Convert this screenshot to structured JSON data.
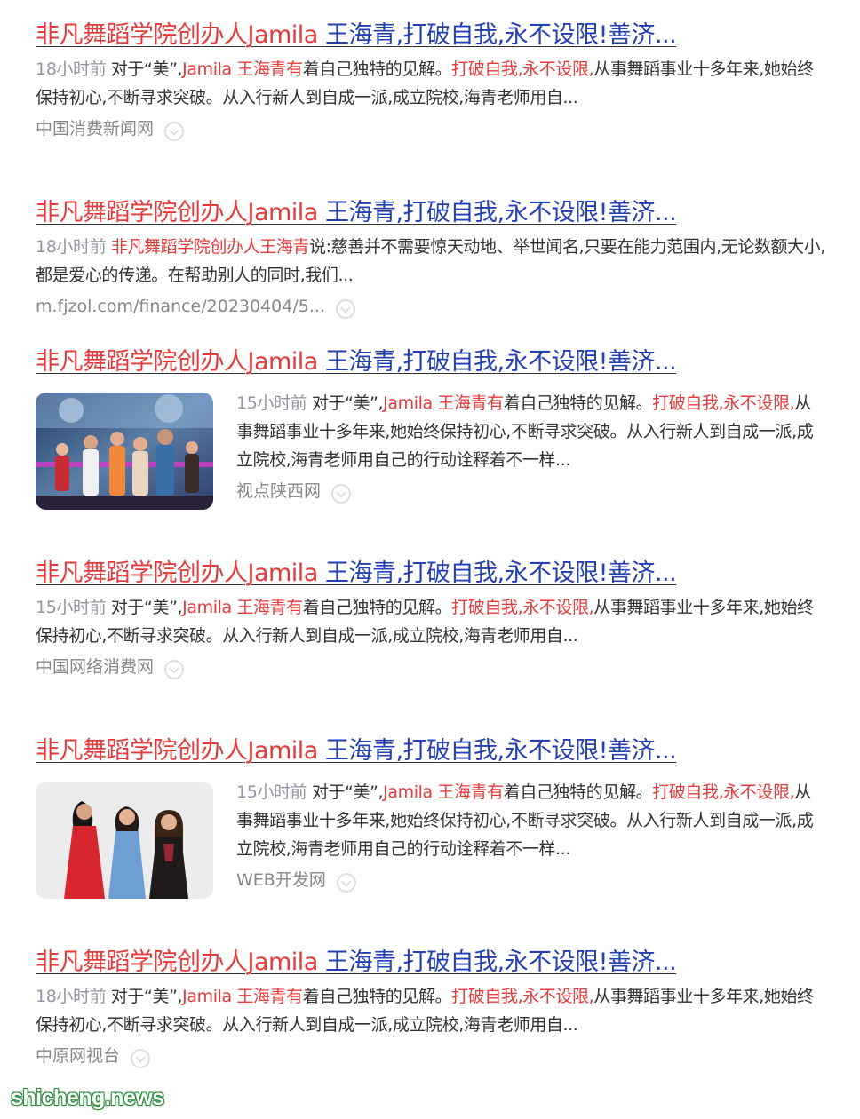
{
  "results": [
    {
      "title_red": "非凡舞蹈学院创办人Jamila ",
      "title_blue": "王海青,打破自我,永不设限!善济...",
      "time": "18小时前",
      "abstract_parts": [
        {
          "text": " 对于“美”,",
          "hl": false
        },
        {
          "text": "Jamila 王海青有",
          "hl": true
        },
        {
          "text": "着自己独特的见解。",
          "hl": false
        },
        {
          "text": "打破自我,永不设限,",
          "hl": true
        },
        {
          "text": "从事舞蹈事业十多年来,她始终保持初心,不断寻求突破。从入行新人到自成一派,成立院校,海青老师用自...",
          "hl": false
        }
      ],
      "source": "中国消费新闻网"
    },
    {
      "title_red": "非凡舞蹈学院创办人Jamila ",
      "title_blue": "王海青,打破自我,永不设限!善济...",
      "time": "18小时前",
      "abstract_parts": [
        {
          "text": " ",
          "hl": false
        },
        {
          "text": "非凡舞蹈学院创办人王海青",
          "hl": true
        },
        {
          "text": "说:慈善并不需要惊天动地、举世闻名,只要在能力范围内,无论数额大小,都是爱心的传递。在帮助别人的同时,我们...",
          "hl": false
        }
      ],
      "source": "m.fjzol.com/finance/20230404/5..."
    },
    {
      "title_red": "非凡舞蹈学院创办人Jamila ",
      "title_blue": "王海青,打破自我,永不设限!善济...",
      "time": "15小时前",
      "abstract_parts": [
        {
          "text": " 对于“美”,",
          "hl": false
        },
        {
          "text": "Jamila 王海青有",
          "hl": true
        },
        {
          "text": "着自己独特的见解。",
          "hl": false
        },
        {
          "text": "打破自我,永不设限,",
          "hl": true
        },
        {
          "text": "从事舞蹈事业十多年来,她始终保持初心,不断寻求突破。从入行新人到自成一派,成立院校,海青老师用自己的行动诠释着不一样...",
          "hl": false
        }
      ],
      "source": "视点陕西网",
      "image": "stage-photo"
    },
    {
      "title_red": "非凡舞蹈学院创办人Jamila ",
      "title_blue": "王海青,打破自我,永不设限!善济...",
      "time": "15小时前",
      "abstract_parts": [
        {
          "text": " 对于“美”,",
          "hl": false
        },
        {
          "text": "Jamila 王海青有",
          "hl": true
        },
        {
          "text": "着自己独特的见解。",
          "hl": false
        },
        {
          "text": "打破自我,永不设限,",
          "hl": true
        },
        {
          "text": "从事舞蹈事业十多年来,她始终保持初心,不断寻求突破。从入行新人到自成一派,成立院校,海青老师用自...",
          "hl": false
        }
      ],
      "source": "中国网络消费网"
    },
    {
      "title_red": "非凡舞蹈学院创办人Jamila ",
      "title_blue": "王海青,打破自我,永不设限!善济...",
      "time": "15小时前",
      "abstract_parts": [
        {
          "text": " 对于“美”,",
          "hl": false
        },
        {
          "text": "Jamila 王海青有",
          "hl": true
        },
        {
          "text": "着自己独特的见解。",
          "hl": false
        },
        {
          "text": "打破自我,永不设限,",
          "hl": true
        },
        {
          "text": "从事舞蹈事业十多年来,她始终保持初心,不断寻求突破。从入行新人到自成一派,成立院校,海青老师用自己的行动诠释着不一样...",
          "hl": false
        }
      ],
      "source": "WEB开发网",
      "image": "portrait-photo"
    },
    {
      "title_red": "非凡舞蹈学院创办人Jamila ",
      "title_blue": "王海青,打破自我,永不设限!善济...",
      "time": "18小时前",
      "abstract_parts": [
        {
          "text": " 对于“美”,",
          "hl": false
        },
        {
          "text": "Jamila 王海青有",
          "hl": true
        },
        {
          "text": "着自己独特的见解。",
          "hl": false
        },
        {
          "text": "打破自我,永不设限,",
          "hl": true
        },
        {
          "text": "从事舞蹈事业十多年来,她始终保持初心,不断寻求突破。从入行新人到自成一派,成立院校,海青老师用自...",
          "hl": false
        }
      ],
      "source": "中原网视台"
    }
  ],
  "watermark": "shicheng.news",
  "colors": {
    "highlight": "#e63b3b",
    "link": "#2440b3",
    "meta": "#9195a3"
  }
}
